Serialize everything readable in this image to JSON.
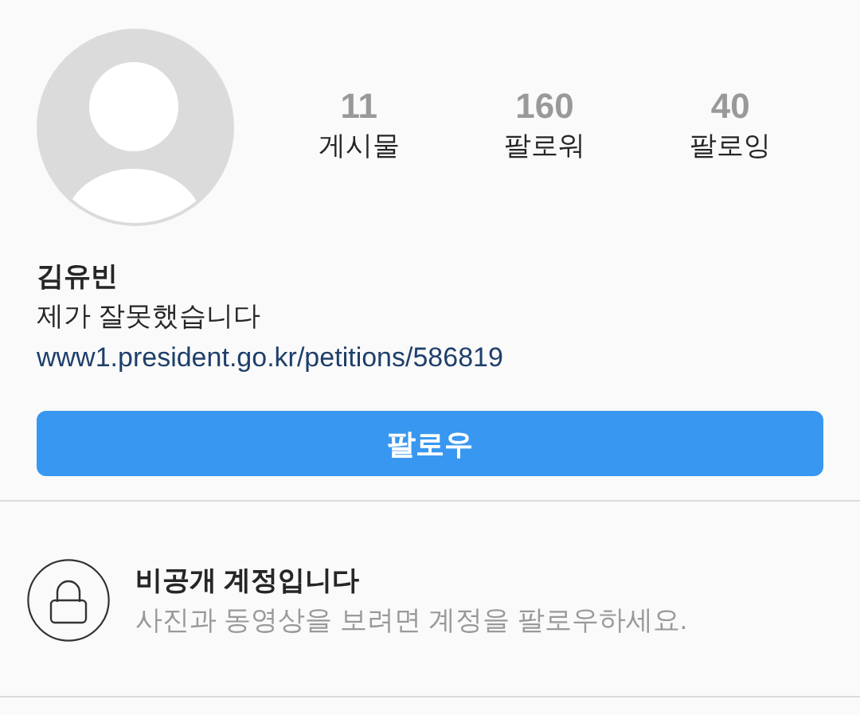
{
  "profile": {
    "stats": [
      {
        "value": "11",
        "label": "게시물"
      },
      {
        "value": "160",
        "label": "팔로워"
      },
      {
        "value": "40",
        "label": "팔로잉"
      }
    ],
    "name": "김유빈",
    "bio": "제가 잘못했습니다",
    "link": "www1.president.go.kr/petitions/586819"
  },
  "follow_button": {
    "label": "팔로우"
  },
  "private_notice": {
    "title": "비공개 계정입니다",
    "message": "사진과 동영상을 보려면 계정을 팔로우하세요."
  }
}
